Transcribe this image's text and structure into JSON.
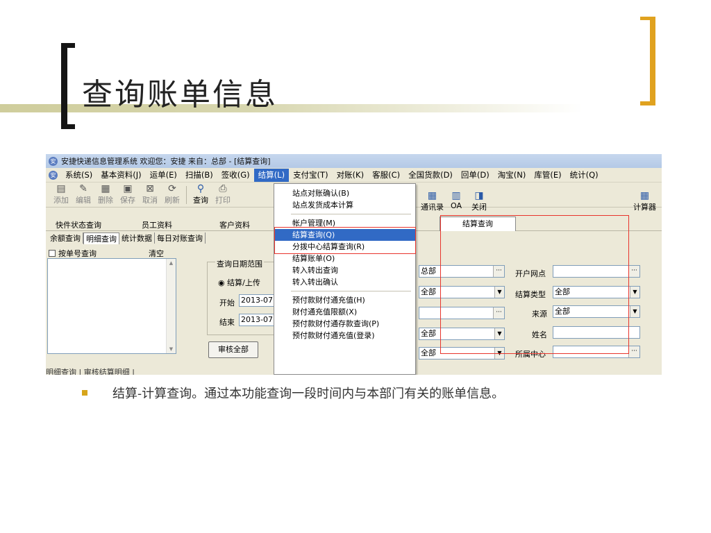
{
  "slide": {
    "title": "查询账单信息",
    "bullet": "结算-计算查询。通过本功能查询一段时间内与本部门有关的账单信息。",
    "accent_color": "#e0a21f",
    "highlight_color": "#e8342c"
  },
  "app": {
    "window_title": "安捷快递信息管理系统 欢迎您：安捷 来自：总部 - [结算查询]",
    "menu": [
      "系统(S)",
      "基本资料(J)",
      "运单(E)",
      "扫描(B)",
      "签收(G)",
      "结算(L)",
      "支付宝(T)",
      "对账(K)",
      "客服(C)",
      "全国货款(D)",
      "回单(D)",
      "淘宝(N)",
      "库管(E)",
      "统计(Q)"
    ],
    "active_menu": "结算(L)",
    "toolbar": [
      "添加",
      "编辑",
      "删除",
      "保存",
      "取消",
      "刷新",
      "查询",
      "打印"
    ],
    "toolbar_right": [
      "通讯录",
      "OA",
      "关闭"
    ],
    "calculator": "计算器",
    "top_tabs": [
      "快件状态查询",
      "员工资料",
      "客户资料"
    ],
    "active_top_tab": "结算查询",
    "sub_tabs": [
      "余额查询",
      "明细查询",
      "统计数据",
      "每日对账查询"
    ],
    "left_panel": {
      "checkbox_label": "按单号查询",
      "clear_label": "清空"
    },
    "date_group": {
      "title": "查询日期范围",
      "radio_label": "结算/上传",
      "start_label": "开始",
      "start_value": "2013-07",
      "end_label": "结束",
      "end_value": "2013-07",
      "review_all_button": "审核全部"
    },
    "dropdown_menu": {
      "group1": [
        "站点对账确认(B)",
        "站点发货成本计算"
      ],
      "group2": [
        "帐户管理(M)",
        "结算查询(Q)",
        "分拨中心结算查询(R)",
        "结算账单(O)",
        "转入转出查询",
        "转入转出确认"
      ],
      "group3": [
        "预付款财付通充值(H)",
        "财付通充值限额(X)",
        "预付款财付通存款查询(P)",
        "预付款财付通充值(登录)"
      ],
      "selected": "结算查询(Q)"
    },
    "form": {
      "field1_value": "总部",
      "field2_value": "全部",
      "field3_value": "",
      "field4_value": "全部",
      "field5_value": "全部",
      "right_labels": [
        "开户网点",
        "结算类型",
        "来源",
        "姓名",
        "所属中心"
      ],
      "right_values": [
        "",
        "全部",
        "全部",
        "",
        ""
      ]
    },
    "bottom_tabs": "明细查询 | 审核结算明细 |"
  }
}
